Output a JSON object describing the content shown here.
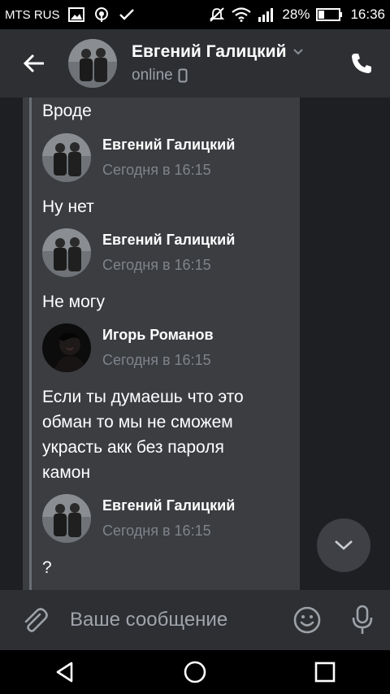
{
  "status_bar": {
    "carrier": "MTS RUS",
    "battery": "28%",
    "time": "16:36"
  },
  "header": {
    "contact_name": "Евгений Галицкий",
    "status": "online"
  },
  "messages": [
    {
      "kind": "text",
      "text": "Вроде"
    },
    {
      "kind": "head",
      "author": "Евгений Галицкий",
      "time": "Сегодня в 16:15",
      "avatar": "photo-two-men"
    },
    {
      "kind": "text",
      "text": "Ну нет"
    },
    {
      "kind": "head",
      "author": "Евгений Галицкий",
      "time": "Сегодня в 16:15",
      "avatar": "photo-two-men"
    },
    {
      "kind": "text",
      "text": "Не могу"
    },
    {
      "kind": "head",
      "author": "Игорь Романов",
      "time": "Сегодня в 16:15",
      "avatar": "photo-dark-portrait"
    },
    {
      "kind": "text",
      "lines": [
        "Если ты думаешь что это",
        "обман то мы не сможем",
        "украсть акк без пароля",
        "камон"
      ]
    },
    {
      "kind": "head",
      "author": "Евгений Галицкий",
      "time": "Сегодня в 16:15",
      "avatar": "photo-two-men"
    },
    {
      "kind": "text",
      "text": "?"
    }
  ],
  "input": {
    "placeholder": "Ваше сообщение",
    "value": ""
  },
  "colors": {
    "header_bg": "#2d2f33",
    "chat_bg": "#1d1f22",
    "bubble_bg": "#3b3d41",
    "muted_text": "#7f848a"
  }
}
